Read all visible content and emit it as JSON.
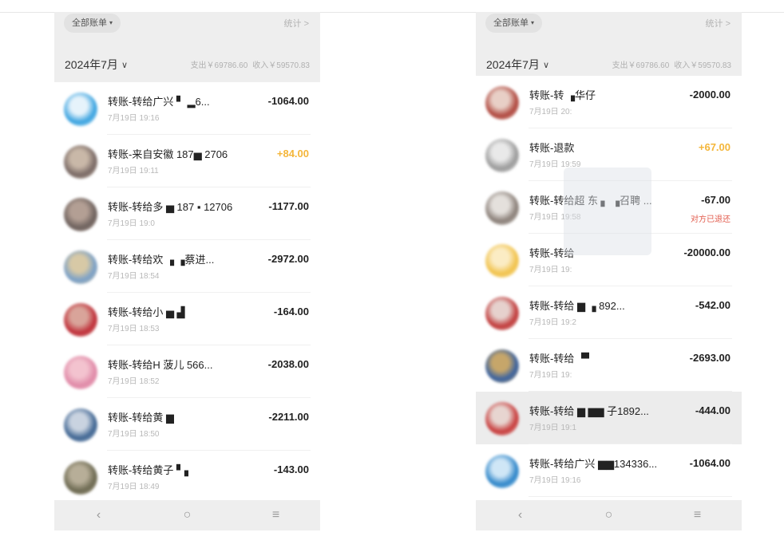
{
  "left": {
    "filter_label": "全部账单",
    "stat_label": "统计 >",
    "month_label": "2024年7月",
    "expense_total": "支出￥69786.60",
    "income_total": "收入￥59570.83",
    "rows": [
      {
        "title": "转账-转给广兴   ▘   ▂6...",
        "time": "7月19日 19:16",
        "amount": "-1064.00",
        "colors": [
          "#3aa3e0",
          "#e6f3fb"
        ]
      },
      {
        "title": "转账-来自安徽  187▅ 2706",
        "time": "7月19日 19:11",
        "amount": "+84.00",
        "colors": [
          "#7a6a66",
          "#c9b8a8"
        ]
      },
      {
        "title": "转账-转给多 ▅  187 ▪ 12706",
        "time": "7月19日 19:0",
        "amount": "-1177.00",
        "colors": [
          "#6e625e",
          "#b39f94"
        ]
      },
      {
        "title": "转账-转给欢   ▗  ▗蔡进...",
        "time": "7月19日 18:54",
        "amount": "-2972.00",
        "colors": [
          "#7aa0c8",
          "#d7c9a6"
        ]
      },
      {
        "title": "转账-转给小 ▅ ▟",
        "time": "7月19日 18:53",
        "amount": "-164.00",
        "colors": [
          "#c0303a",
          "#d9a49a"
        ]
      },
      {
        "title": "转账-转给H  菠儿  566...",
        "time": "7月19日 18:52",
        "amount": "-2038.00",
        "colors": [
          "#e08aa8",
          "#f3c3cf"
        ]
      },
      {
        "title": "转账-转给黄 ▆",
        "time": "7月19日 18:50",
        "amount": "-2211.00",
        "colors": [
          "#3f6592",
          "#c9d3e0"
        ]
      },
      {
        "title": "转账-转给黄子  ▘▖",
        "time": "7月19日 18:49",
        "amount": "-143.00",
        "colors": [
          "#6d6a52",
          "#b7ae98"
        ]
      }
    ]
  },
  "right": {
    "filter_label": "全部账单",
    "stat_label": "统计 >",
    "month_label": "2024年7月",
    "expense_total": "支出￥69786.60",
    "income_total": "收入￥59570.83",
    "rows": [
      {
        "title": "转账-转  ▗华仔",
        "time": "7月19日 20:",
        "amount": "-2000.00",
        "colors": [
          "#b0483f",
          "#e8cfc6"
        ]
      },
      {
        "title": "转账-退款",
        "time": "7月19日 19:59",
        "amount": "+67.00",
        "colors": [
          "#9a9a9a",
          "#e9e9e9"
        ]
      },
      {
        "title": "转账-转给超 东  ▖ ▗召聘 ...",
        "time": "7月19日 19:58",
        "amount": "-67.00",
        "note": "对方已退还",
        "colors": [
          "#8a7f78",
          "#e4e0dc"
        ]
      },
      {
        "title": "转账-转给",
        "time": "7月19日 19:",
        "amount": "-20000.00",
        "colors": [
          "#f1c24b",
          "#fbecc4"
        ]
      },
      {
        "title": "转账-转给  ▆   ▗ 892...",
        "time": "7月19日 19:2",
        "amount": "-542.00",
        "colors": [
          "#c13a3a",
          "#e6d1cd"
        ]
      },
      {
        "title": "转账-转给  ▝▘",
        "time": "7月19日 19:",
        "amount": "-2693.00",
        "colors": [
          "#3a62a0",
          "#c6a66a"
        ]
      },
      {
        "title": "转账-转给  ▆ ▆▆ 子1892...",
        "time": "7月19日 19:1",
        "amount": "-444.00",
        "colors": [
          "#c83c3c",
          "#e7d5d0"
        ]
      },
      {
        "title": "转账-转给广兴 ▆▆134336...",
        "time": "7月19日 19:16",
        "amount": "-1064.00",
        "colors": [
          "#2f86c9",
          "#cfe6f6"
        ]
      }
    ]
  },
  "nav": {
    "back": "‹",
    "home": "○",
    "menu": "≡"
  }
}
